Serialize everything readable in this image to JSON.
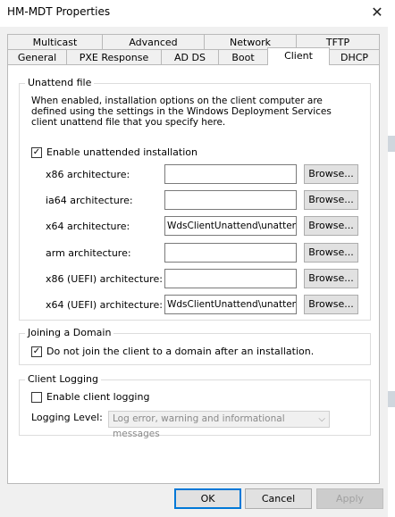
{
  "window": {
    "title": "HM-MDT Properties",
    "close_glyph": "✕"
  },
  "tabs_row1": [
    {
      "label": "Multicast"
    },
    {
      "label": "Advanced"
    },
    {
      "label": "Network"
    },
    {
      "label": "TFTP"
    }
  ],
  "tabs_row2": [
    {
      "label": "General"
    },
    {
      "label": "PXE Response"
    },
    {
      "label": "AD DS"
    },
    {
      "label": "Boot"
    },
    {
      "label": "Client",
      "active": true
    },
    {
      "label": "DHCP"
    }
  ],
  "unattend": {
    "group_label": "Unattend file",
    "description": "When enabled, installation options on the client computer are defined using the settings in the Windows Deployment Services client unattend file that you specify here.",
    "enable_label": "Enable unattended installation",
    "enable_checked": true,
    "rows": [
      {
        "label": "x86 architecture:",
        "value": "",
        "browse": "Browse..."
      },
      {
        "label": "ia64 architecture:",
        "value": "",
        "browse": "Browse..."
      },
      {
        "label": "x64 architecture:",
        "value": "WdsClientUnattend\\unattend.xml",
        "browse": "Browse..."
      },
      {
        "label": "arm architecture:",
        "value": "",
        "browse": "Browse..."
      },
      {
        "label": "x86 (UEFI) architecture:",
        "value": "",
        "browse": "Browse..."
      },
      {
        "label": "x64 (UEFI) architecture:",
        "value": "WdsClientUnattend\\unattend.xml",
        "browse": "Browse..."
      }
    ]
  },
  "domain": {
    "group_label": "Joining a Domain",
    "checkbox_label": "Do not join the client to a domain after an installation.",
    "checked": true
  },
  "logging": {
    "group_label": "Client Logging",
    "checkbox_label": "Enable client logging",
    "checked": false,
    "level_label": "Logging Level:",
    "level_value": "Log error, warning and informational messages"
  },
  "buttons": {
    "ok": "OK",
    "cancel": "Cancel",
    "apply": "Apply"
  }
}
